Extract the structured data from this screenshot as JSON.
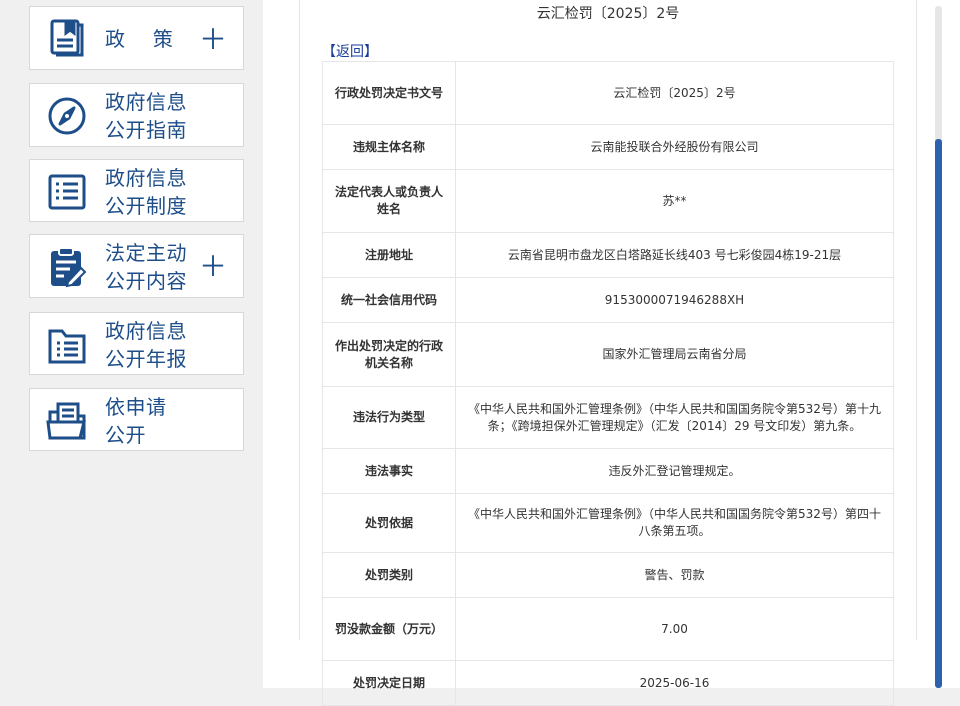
{
  "sidebar": {
    "items": [
      {
        "label": "政    策",
        "icon": "book-icon",
        "plus": "＋"
      },
      {
        "label": "政府信息\n公开指南",
        "icon": "compass-icon"
      },
      {
        "label": "政府信息\n公开制度",
        "icon": "list-document-icon"
      },
      {
        "label": "法定主动\n公开内容",
        "icon": "clipboard-edit-icon",
        "plus": "＋"
      },
      {
        "label": "政府信息\n公开年报",
        "icon": "folder-list-icon"
      },
      {
        "label": "依申请\n公开",
        "icon": "folder-document-icon"
      }
    ]
  },
  "main": {
    "doc_title": "云汇检罚〔2025〕2号",
    "back_label": "【返回】",
    "rows": [
      {
        "key": "行政处罚决定书文号",
        "value": "云汇检罚〔2025〕2号"
      },
      {
        "key": "违规主体名称",
        "value": "云南能投联合外经股份有限公司"
      },
      {
        "key": "法定代表人或负责人姓名",
        "value": "苏**"
      },
      {
        "key": "注册地址",
        "value": "云南省昆明市盘龙区白塔路延长线403 号七彩俊园4栋19-21层"
      },
      {
        "key": "统一社会信用代码",
        "value": "9153000071946288XH"
      },
      {
        "key": "作出处罚决定的行政机关名称",
        "value": "国家外汇管理局云南省分局"
      },
      {
        "key": "违法行为类型",
        "value": "《中华人民共和国外汇管理条例》（中华人民共和国国务院令第532号）第十九条；《跨境担保外汇管理规定》（汇发〔2014〕29 号文印发）第九条。"
      },
      {
        "key": "违法事实",
        "value": "违反外汇登记管理规定。"
      },
      {
        "key": "处罚依据",
        "value": "《中华人民共和国外汇管理条例》（中华人民共和国国务院令第532号）第四十八条第五项。"
      },
      {
        "key": "处罚类别",
        "value": "警告、罚款"
      },
      {
        "key": "罚没款金额（万元）",
        "value": "7.00"
      },
      {
        "key": "处罚决定日期",
        "value": "2025-06-16"
      }
    ]
  },
  "colors": {
    "accent": "#1d4e89",
    "link": "#1a3d9b",
    "scroll_thumb": "#2d61ad"
  }
}
